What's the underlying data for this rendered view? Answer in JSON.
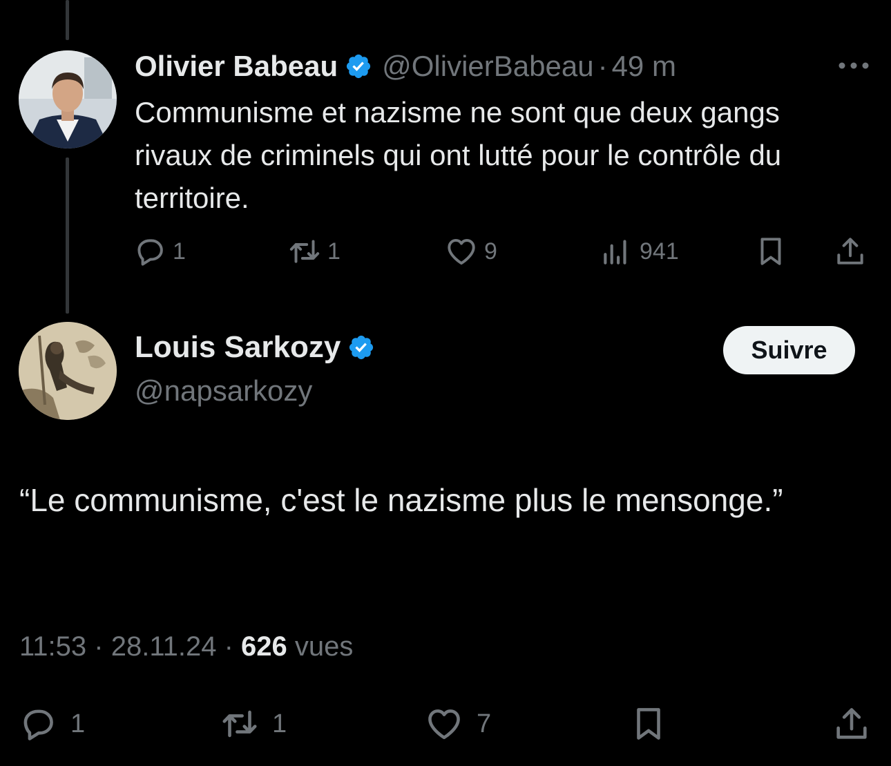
{
  "parent_tweet": {
    "author_name": "Olivier Babeau",
    "handle": "@OlivierBabeau",
    "separator": "·",
    "time_ago": "49 m",
    "text": "Communisme et nazisme ne sont que deux gangs rivaux de criminels qui ont lutté pour le contrôle du territoire.",
    "actions": {
      "replies": "1",
      "reposts": "1",
      "likes": "9",
      "views": "941"
    },
    "icons": {
      "reply": "reply-icon",
      "repost": "repost-icon",
      "like": "heart-icon",
      "views": "views-bar-chart-icon",
      "bookmark": "bookmark-icon",
      "share": "share-icon",
      "more": "more-dots-icon",
      "verified": "verified-badge-icon"
    }
  },
  "main_tweet": {
    "author_name": "Louis Sarkozy",
    "handle": "@napsarkozy",
    "follow_label": "Suivre",
    "text": "“Le communisme, c'est le nazisme plus le mensonge.”",
    "time": "11:53",
    "separator": "·",
    "date": "28.11.24",
    "views_count": "626",
    "views_label": "vues",
    "actions": {
      "replies": "1",
      "reposts": "1",
      "likes": "7"
    }
  },
  "colors": {
    "background": "#000000",
    "text_primary": "#e7e9ea",
    "text_secondary": "#71767b",
    "verified_blue": "#1d9bf0",
    "follow_button_bg": "#eff3f4",
    "thread_line": "#333639"
  }
}
